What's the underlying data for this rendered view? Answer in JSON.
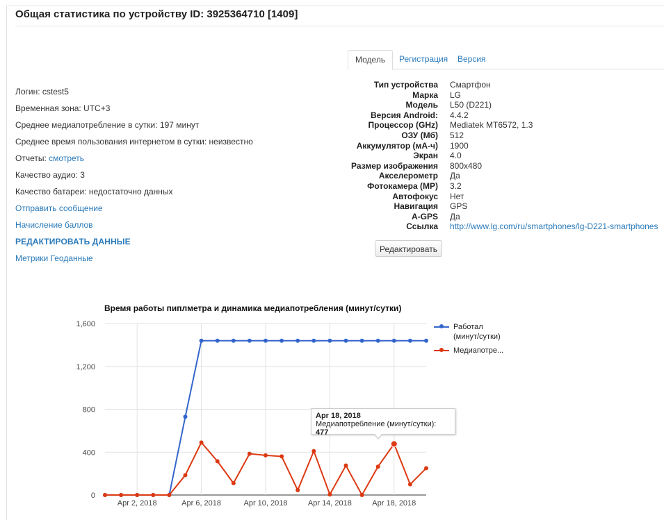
{
  "page": {
    "title": "Общая статистика по устройству ID: 3925364710 [1409]"
  },
  "left_info": {
    "login_label": "Логин: cstest5",
    "timezone_label": "Временная зона: UTC+3",
    "media_avg_label": "Среднее медиапотребление в сутки: 197 минут",
    "internet_avg_label": "Среднее время пользования интернетом в сутки: неизвестно",
    "reports_label": "Отчеты: ",
    "reports_link": "смотреть",
    "audio_quality_label": "Качество аудио: 3",
    "battery_quality_label": "Качество батареи: недостаточно данных",
    "send_message_link": "Отправить сообщение",
    "points_link": "Начисление баллов",
    "edit_data_link": "РЕДАКТИРОВАТЬ ДАННЫЕ",
    "metrics_geo_link": "Метрики Геоданные"
  },
  "tabs": [
    "Модель",
    "Регистрация",
    "Версия"
  ],
  "spec": {
    "rows": [
      {
        "label": "Тип устройства",
        "value": "Смартфон"
      },
      {
        "label": "Марка",
        "value": "LG"
      },
      {
        "label": "Модель",
        "value": "L50 (D221)"
      },
      {
        "label": "Версия Android:",
        "value": "4.4.2"
      },
      {
        "label": "Процессор (GHz)",
        "value": "Mediatek MT6572, 1.3"
      },
      {
        "label": "ОЗУ (Мб)",
        "value": "512"
      },
      {
        "label": "Аккумулятор (мА-ч)",
        "value": "1900"
      },
      {
        "label": "Экран",
        "value": "4.0"
      },
      {
        "label": "Размер изображения",
        "value": "800x480"
      },
      {
        "label": "Акселерометр",
        "value": "Да"
      },
      {
        "label": "Фотокамера (MP)",
        "value": "3.2"
      },
      {
        "label": "Автофокус",
        "value": "Нет"
      },
      {
        "label": "Навигация",
        "value": "GPS"
      },
      {
        "label": "A-GPS",
        "value": "Да"
      },
      {
        "label": "Ссылка",
        "value": "http://www.lg.com/ru/smartphones/lg-D221-smartphones"
      }
    ],
    "edit_button": "Редактировать"
  },
  "chart_data": {
    "type": "line",
    "title": "Время работы пиплметра и динамика медиапотребления (минут/сутки)",
    "x": [
      "Mar 31, 2018",
      "Apr 1, 2018",
      "Apr 2, 2018",
      "Apr 3, 2018",
      "Apr 4, 2018",
      "Apr 5, 2018",
      "Apr 6, 2018",
      "Apr 7, 2018",
      "Apr 8, 2018",
      "Apr 9, 2018",
      "Apr 10, 2018",
      "Apr 11, 2018",
      "Apr 12, 2018",
      "Apr 13, 2018",
      "Apr 14, 2018",
      "Apr 15, 2018",
      "Apr 16, 2018",
      "Apr 17, 2018",
      "Apr 18, 2018",
      "Apr 19, 2018",
      "Apr 20, 2018"
    ],
    "x_tick_labels": [
      "Apr 2, 2018",
      "Apr 6, 2018",
      "Apr 10, 2018",
      "Apr 14, 2018",
      "Apr 18, 2018"
    ],
    "ylim": [
      0,
      1600
    ],
    "y_ticks": [
      "0",
      "400",
      "800",
      "1,200",
      "1,600"
    ],
    "grid": true,
    "legend_position": "right",
    "series": [
      {
        "name": "Работал (минут/сутки)",
        "legend_label": [
          "Работал",
          "(минут/сутки)"
        ],
        "color": "#3366cc",
        "values": [
          0,
          0,
          0,
          0,
          0,
          730,
          1440,
          1440,
          1440,
          1440,
          1440,
          1440,
          1440,
          1440,
          1440,
          1440,
          1440,
          1440,
          1440,
          1440,
          1440
        ]
      },
      {
        "name": "Медиапотребление (минут/сутки)",
        "legend_label": [
          "Медиапотре..."
        ],
        "color": "#dc3912",
        "values": [
          0,
          0,
          0,
          0,
          0,
          185,
          490,
          315,
          110,
          385,
          370,
          360,
          45,
          410,
          5,
          275,
          0,
          265,
          477,
          100,
          250
        ]
      }
    ],
    "tooltip": {
      "date": "Apr 18, 2018",
      "series_label": "Медиапотребление (минут/сутки): ",
      "value": "477"
    }
  }
}
